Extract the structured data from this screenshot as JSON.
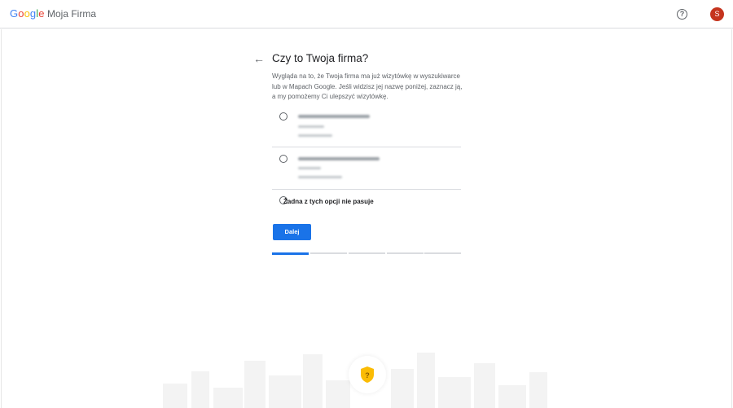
{
  "header": {
    "logo_letters": [
      "G",
      "o",
      "o",
      "g",
      "l",
      "e"
    ],
    "product_name": "Moja Firma",
    "help_icon": "help-circle-icon",
    "help_glyph": "?",
    "avatar_initial": "S",
    "avatar_color": "#c5341e"
  },
  "main": {
    "back_icon": "arrow-back-icon",
    "back_glyph": "←",
    "title": "Czy to Twoja firma?",
    "description": "Wygląda na to, że Twoja firma ma już wizytówkę w wyszukiwarce lub w Mapach Google. Jeśli widzisz jej nazwę poniżej, zaznacz ją, a my pomożemy Ci ulepszyć wizytówkę.",
    "options": [
      {
        "blurred": true
      },
      {
        "blurred": true
      }
    ],
    "none_option_label": "Żadna z tych opcji nie pasuje",
    "next_button_label": "Dalej",
    "progress": {
      "steps": 5,
      "current": 1
    }
  },
  "footer": {
    "illustration_icon": "shield-question-icon"
  },
  "colors": {
    "accent": "#1a73e8",
    "shield": "#fbbc04"
  }
}
